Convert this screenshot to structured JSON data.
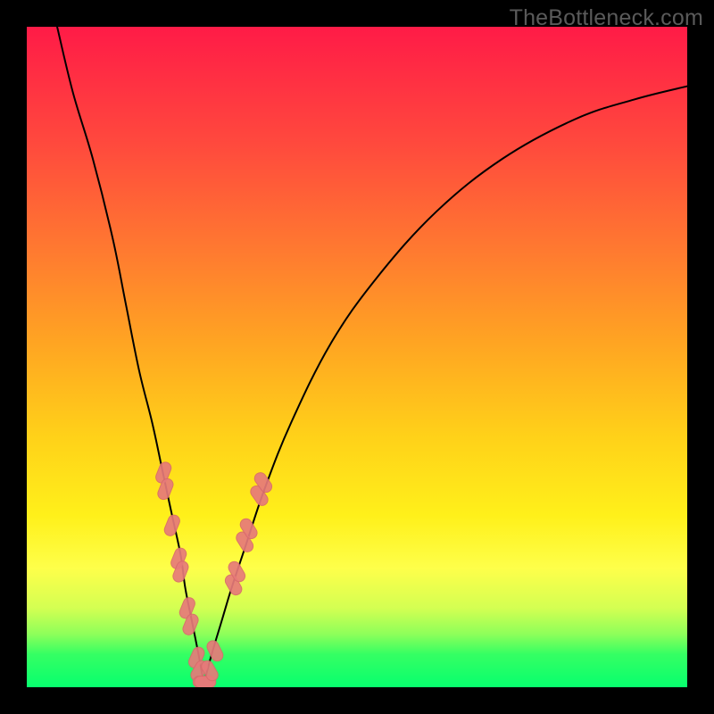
{
  "watermark": {
    "text": "TheBottleneck.com"
  },
  "colors": {
    "background": "#000000",
    "gradient_top": "#ff1b47",
    "gradient_mid1": "#ff7a30",
    "gradient_mid2": "#ffd119",
    "gradient_mid3": "#feff4a",
    "gradient_bottom": "#07ff6e",
    "curve": "#000000",
    "marker_fill": "#e77a7a",
    "marker_stroke": "#d86b6b"
  },
  "chart_data": {
    "type": "line",
    "title": "",
    "xlabel": "",
    "ylabel": "",
    "xlim": [
      0,
      100
    ],
    "ylim": [
      0,
      100
    ],
    "legend": false,
    "grid": false,
    "note": "Axes have no visible tick labels; values are estimated in percent of plot width/height. y=100 is top, y=0 is bottom.",
    "series": [
      {
        "name": "left-branch",
        "x": [
          4.6,
          7,
          10,
          13,
          15,
          17,
          19,
          20.5,
          22,
          23.3,
          24,
          25,
          26,
          26.8
        ],
        "y": [
          100,
          90,
          80,
          68,
          58,
          48,
          40,
          33,
          26,
          20,
          15,
          10,
          5,
          0.5
        ]
      },
      {
        "name": "right-branch",
        "x": [
          26.8,
          28,
          29.5,
          31,
          33,
          36,
          40,
          46,
          53,
          62,
          72,
          83,
          92,
          100
        ],
        "y": [
          0.5,
          5,
          10,
          15,
          21,
          30,
          40,
          52,
          62,
          72,
          80,
          86,
          89,
          91
        ]
      }
    ],
    "markers": {
      "name": "highlighted-capsules",
      "shape": "capsule",
      "points": [
        {
          "x": 20.7,
          "y": 32.5,
          "angle": -68
        },
        {
          "x": 21.0,
          "y": 30.0,
          "angle": -68
        },
        {
          "x": 22.0,
          "y": 24.5,
          "angle": -68
        },
        {
          "x": 23.0,
          "y": 19.5,
          "angle": -68
        },
        {
          "x": 23.3,
          "y": 17.5,
          "angle": -68
        },
        {
          "x": 24.3,
          "y": 12.0,
          "angle": -68
        },
        {
          "x": 24.8,
          "y": 9.5,
          "angle": -68
        },
        {
          "x": 25.7,
          "y": 4.5,
          "angle": -66
        },
        {
          "x": 26.1,
          "y": 2.5,
          "angle": -60
        },
        {
          "x": 26.8,
          "y": 0.8,
          "angle": 0
        },
        {
          "x": 27.0,
          "y": 0.8,
          "angle": 0
        },
        {
          "x": 27.7,
          "y": 2.5,
          "angle": 60
        },
        {
          "x": 28.5,
          "y": 5.5,
          "angle": 64
        },
        {
          "x": 31.3,
          "y": 15.5,
          "angle": 60
        },
        {
          "x": 31.8,
          "y": 17.5,
          "angle": 60
        },
        {
          "x": 33.0,
          "y": 22.0,
          "angle": 58
        },
        {
          "x": 33.6,
          "y": 24.0,
          "angle": 58
        },
        {
          "x": 35.2,
          "y": 29.0,
          "angle": 55
        },
        {
          "x": 35.8,
          "y": 31.0,
          "angle": 55
        }
      ]
    }
  }
}
